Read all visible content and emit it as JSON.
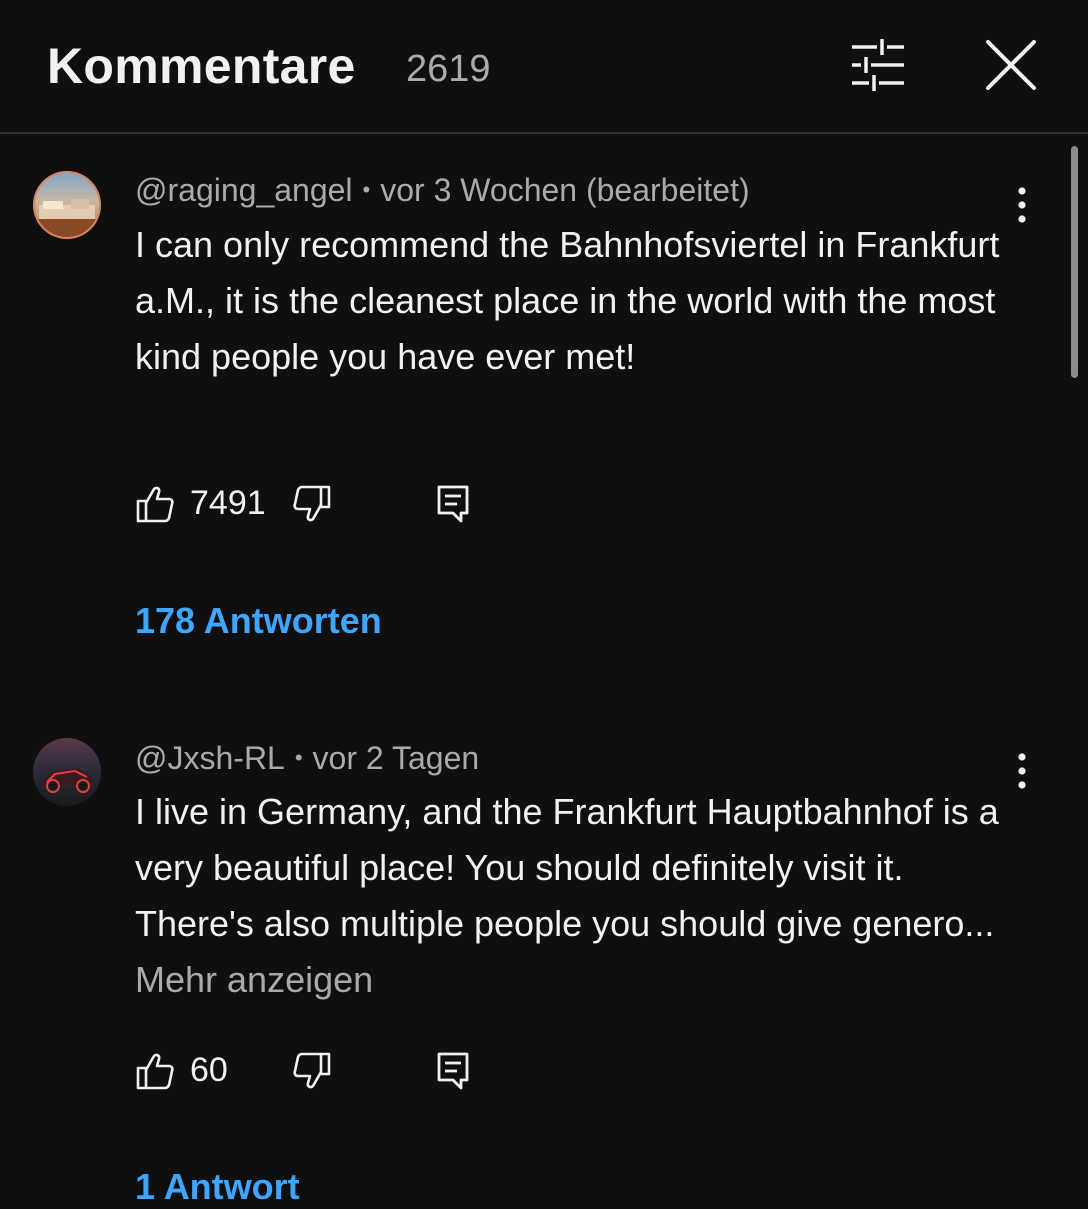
{
  "header": {
    "title": "Kommentare",
    "count": "2619",
    "filter_icon": "sliders-icon",
    "close_icon": "close-icon"
  },
  "comments": [
    {
      "author": "@raging_angel",
      "time": "vor 3 Wochen (bearbeitet)",
      "text": "I can only recommend the Bahnhofsviertel in Frankfurt a.M., it is the cleanest place in the world with the most kind people you have ever met!",
      "more_label": "",
      "likes": "7491",
      "replies_label": "178 Antworten"
    },
    {
      "author": "@Jxsh-RL",
      "time": "vor 2 Tagen",
      "text": "I live in Germany, and the Frankfurt Hauptbahnhof is a very beautiful place! You should definitely visit it. There's also multiple people you should give genero... ",
      "more_label": "Mehr anzeigen",
      "likes": "60",
      "replies_label": "1 Antwort"
    }
  ],
  "colors": {
    "background": "#0f0f0f",
    "text": "#f1f1f1",
    "secondary_text": "#aaaaaa",
    "link": "#3ea6ff"
  }
}
